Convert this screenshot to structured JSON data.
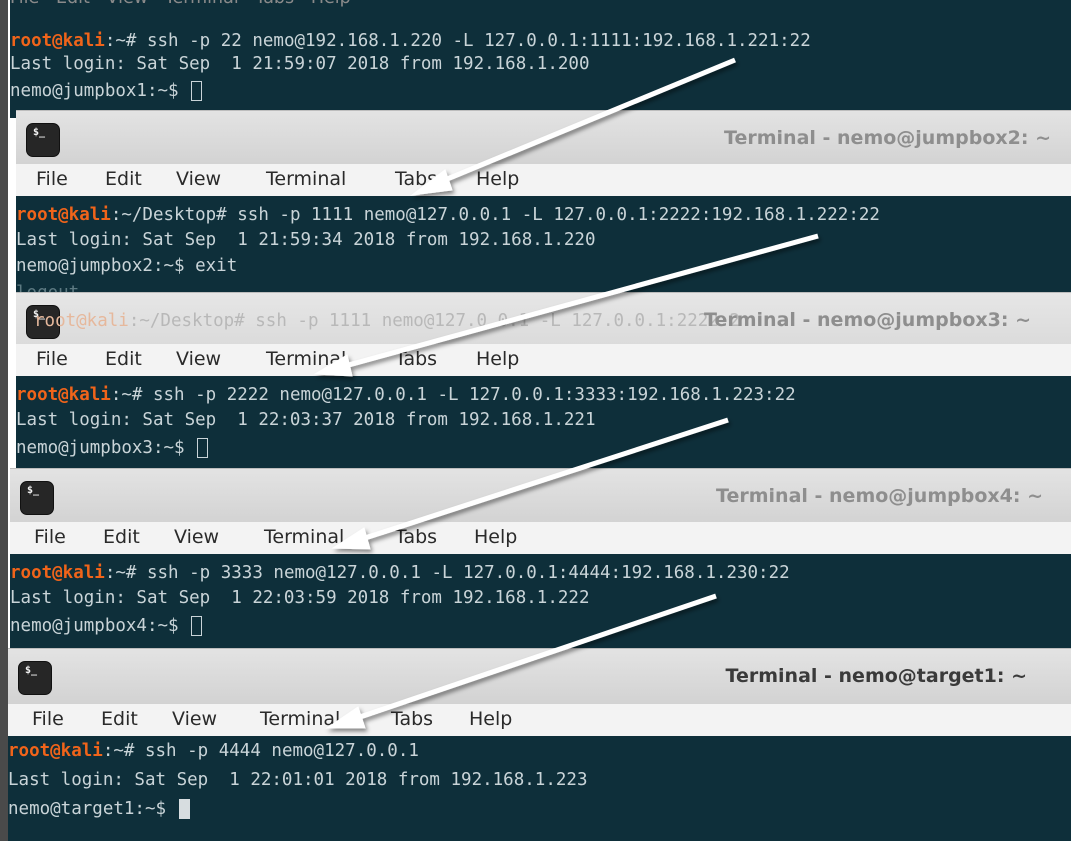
{
  "top_menu_cut": "File   Edit   View   Terminal   Tabs   Help",
  "menu": [
    "File",
    "Edit",
    "View",
    "Terminal",
    "Tabs",
    "Help"
  ],
  "icon_glyph": "$_",
  "windows": [
    {
      "title": "",
      "cmd_user": "root@kali",
      "cmd_rest": ":~# ssh -p 22 nemo@192.168.1.220 -L 127.0.0.1:1111:192.168.1.221:22",
      "last_login": "Last login: Sat Sep  1 21:59:07 2018 from 192.168.1.200",
      "prompt": "nemo@jumpbox1:~$ "
    },
    {
      "title": "Terminal - nemo@jumpbox2: ~",
      "cmd_user": "root@kali",
      "cmd_rest": ":~/Desktop# ssh -p 1111 nemo@127.0.0.1 -L 127.0.0.1:2222:192.168.1.222:22",
      "last_login": "Last login: Sat Sep  1 21:59:34 2018 from 192.168.1.220",
      "prompt": "nemo@jumpbox2:~$ exit",
      "extra": "logout"
    },
    {
      "title": "Terminal - nemo@jumpbox3: ~",
      "ghost_user": "root@kali",
      "ghost_rest": ":~/Desktop# ssh -p 1111 nemo@127.0.0.1 -L 127.0.0.1:2222:2",
      "cmd_user": "root@kali",
      "cmd_rest": ":~# ssh -p 2222 nemo@127.0.0.1 -L 127.0.0.1:3333:192.168.1.223:22",
      "last_login": "Last login: Sat Sep  1 22:03:37 2018 from 192.168.1.221",
      "prompt": "nemo@jumpbox3:~$ "
    },
    {
      "title": "Terminal - nemo@jumpbox4: ~",
      "cmd_user": "root@kali",
      "cmd_rest": ":~# ssh -p 3333 nemo@127.0.0.1 -L 127.0.0.1:4444:192.168.1.230:22",
      "last_login": "Last login: Sat Sep  1 22:03:59 2018 from 192.168.1.222",
      "prompt": "nemo@jumpbox4:~$ "
    },
    {
      "title": "Terminal - nemo@target1: ~",
      "cmd_user": "root@kali",
      "cmd_rest": ":~# ssh -p 4444 nemo@127.0.0.1",
      "last_login": "Last login: Sat Sep  1 22:01:01 2018 from 192.168.1.223",
      "prompt": "nemo@target1:~$ "
    }
  ]
}
